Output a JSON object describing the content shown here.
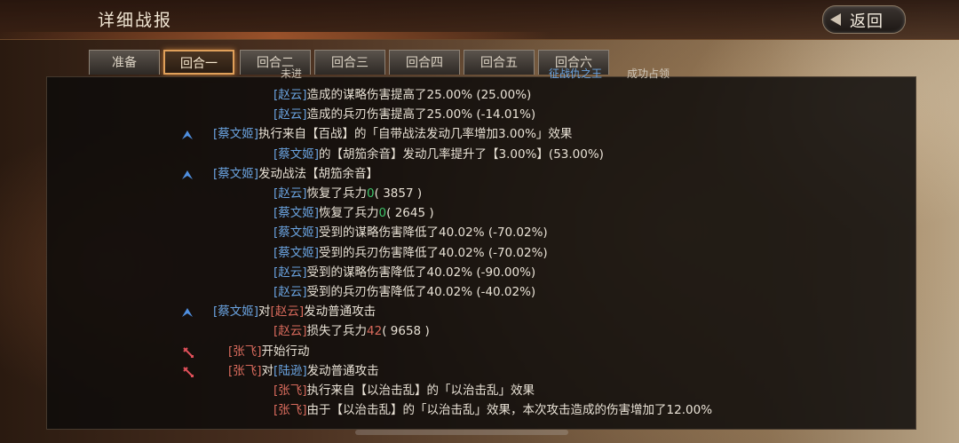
{
  "header": {
    "title": "详细战报",
    "back_label": "返回"
  },
  "tabs": [
    {
      "label": "准备",
      "active": false
    },
    {
      "label": "回合一",
      "active": true
    },
    {
      "label": "回合二",
      "active": false
    },
    {
      "label": "回合三",
      "active": false
    },
    {
      "label": "回合四",
      "active": false
    },
    {
      "label": "回合五",
      "active": false
    },
    {
      "label": "回合六",
      "active": false
    }
  ],
  "top_fragment": {
    "left_text": "未进",
    "highlight": "征战仇之王",
    "right_text": "成功占领"
  },
  "log": [
    {
      "icon": "",
      "parts": [
        [
          "blue",
          "[赵云]"
        ],
        [
          "",
          "造成的谋略伤害提高了25.00% (25.00%)"
        ]
      ]
    },
    {
      "icon": "",
      "parts": [
        [
          "blue",
          "[赵云]"
        ],
        [
          "",
          "造成的兵刃伤害提高了25.00% (-14.01%)"
        ]
      ]
    },
    {
      "icon": "blue-arrow-icon",
      "parts": [
        [
          "blue",
          "[蔡文姬]"
        ],
        [
          "",
          "执行来自【百战】的「自带战法发动几率增加3.00%」效果"
        ]
      ]
    },
    {
      "icon": "",
      "parts": [
        [
          "blue",
          "[蔡文姬]"
        ],
        [
          "",
          "的【胡笳余音】发动几率提升了【3.00%】(53.00%)"
        ]
      ]
    },
    {
      "icon": "blue-arrow-icon",
      "parts": [
        [
          "blue",
          "[蔡文姬]"
        ],
        [
          "",
          "发动战法【胡笳余音】"
        ]
      ]
    },
    {
      "icon": "",
      "parts": [
        [
          "blue",
          "[赵云]"
        ],
        [
          "",
          "恢复了兵力"
        ],
        [
          "green",
          "0"
        ],
        [
          "",
          "( 3857 )"
        ]
      ]
    },
    {
      "icon": "",
      "parts": [
        [
          "blue",
          "[蔡文姬]"
        ],
        [
          "",
          "恢复了兵力"
        ],
        [
          "green",
          "0"
        ],
        [
          "",
          "( 2645 )"
        ]
      ]
    },
    {
      "icon": "",
      "parts": [
        [
          "blue",
          "[蔡文姬]"
        ],
        [
          "",
          "受到的谋略伤害降低了40.02% (-70.02%)"
        ]
      ]
    },
    {
      "icon": "",
      "parts": [
        [
          "blue",
          "[蔡文姬]"
        ],
        [
          "",
          "受到的兵刃伤害降低了40.02% (-70.02%)"
        ]
      ]
    },
    {
      "icon": "",
      "parts": [
        [
          "blue",
          "[赵云]"
        ],
        [
          "",
          "受到的谋略伤害降低了40.02% (-90.00%)"
        ]
      ]
    },
    {
      "icon": "",
      "parts": [
        [
          "blue",
          "[赵云]"
        ],
        [
          "",
          "受到的兵刃伤害降低了40.02% (-40.02%)"
        ]
      ]
    },
    {
      "icon": "blue-arrow-icon",
      "parts": [
        [
          "blue",
          "[蔡文姬]"
        ],
        [
          "",
          "对"
        ],
        [
          "red",
          "[赵云]"
        ],
        [
          "",
          "发动普通攻击"
        ]
      ]
    },
    {
      "icon": "",
      "parts": [
        [
          "red",
          "[赵云]"
        ],
        [
          "",
          "损失了兵力"
        ],
        [
          "red",
          "42"
        ],
        [
          "",
          "( 9658 )"
        ]
      ]
    },
    {
      "icon": "red-swords-icon",
      "parts": [
        [
          "red",
          "[张飞]"
        ],
        [
          "",
          "开始行动"
        ]
      ]
    },
    {
      "icon": "red-swords-icon",
      "parts": [
        [
          "red",
          "[张飞]"
        ],
        [
          "",
          "对"
        ],
        [
          "blue",
          "[陆逊]"
        ],
        [
          "",
          "发动普通攻击"
        ]
      ]
    },
    {
      "icon": "",
      "parts": [
        [
          "red",
          "[张飞]"
        ],
        [
          "",
          "执行来自【以治击乱】的「以治击乱」效果"
        ]
      ]
    },
    {
      "icon": "",
      "parts": [
        [
          "red",
          "[张飞]"
        ],
        [
          "",
          "由于【以治击乱】的「以治击乱」效果，本次攻击造成的伤害增加了12.00%"
        ]
      ]
    }
  ],
  "colors": {
    "ally": "#6aa3e0",
    "enemy": "#d86a5c",
    "heal": "#3fc46a",
    "tab_active_border": "#e0a05a"
  }
}
